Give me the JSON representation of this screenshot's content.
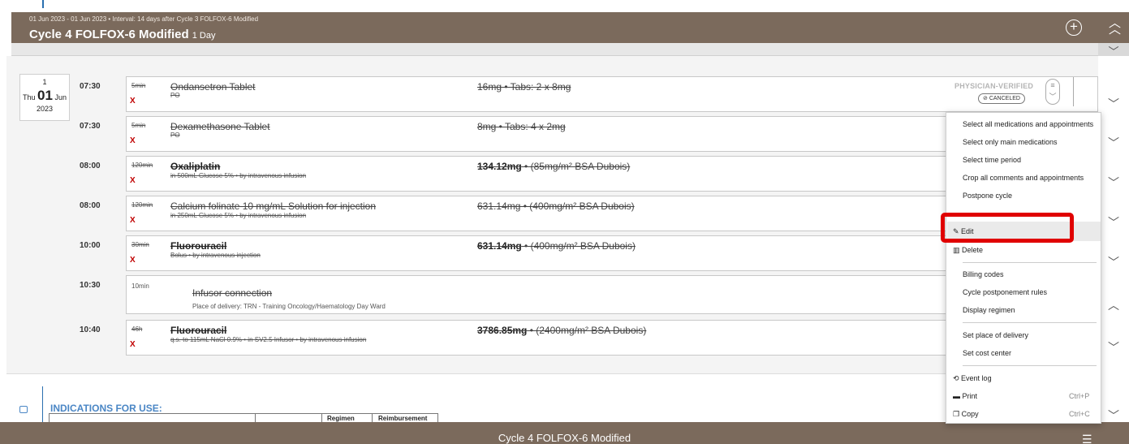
{
  "cycle": {
    "subtitle": "01 Jun 2023 - 01 Jun 2023 • Interval: 14 days after Cycle 3 FOLFOX-6 Modified",
    "title": "Cycle 4 FOLFOX-6 Modified",
    "days": "1 Day"
  },
  "date": {
    "day_num": "1",
    "weekday": "Thu",
    "day": "01",
    "month": "Jun",
    "year": "2023"
  },
  "status": {
    "verified": "PHYSICIAN-VERIFIED",
    "canceled": "CANCELED"
  },
  "rows": [
    {
      "time": "07:30",
      "duration": "5min",
      "name": "Ondansetron Tablet",
      "sub": "PO",
      "dose": "16mg • Tabs: 2 x 8mg",
      "dose_bold": "",
      "cancel": "X"
    },
    {
      "time": "07:30",
      "duration": "5min",
      "name": "Dexamethasone Tablet",
      "sub": "PO",
      "dose": "8mg • Tabs: 4 x 2mg",
      "dose_bold": "",
      "cancel": "X"
    },
    {
      "time": "08:00",
      "duration": "120min",
      "name": "Oxaliplatin",
      "sub": "in 500mL Glucose 5% • by intravenous infusion",
      "dose_bold": "134.12mg",
      "dose": " • (85mg/m² BSA Dubois)",
      "cancel": "X"
    },
    {
      "time": "08:00",
      "duration": "120min",
      "name": "Calcium folinate 10 mg/mL Solution for injection",
      "sub": "in 250mL Glucose 5% • by intravenous infusion",
      "dose": "631.14mg • (400mg/m² BSA Dubois)",
      "dose_bold": "",
      "cancel": "X"
    },
    {
      "time": "10:00",
      "duration": "30min",
      "name": "Fluorouracil",
      "sub": "Bolus • by intravenous injection",
      "dose_bold": "631.14mg",
      "dose": " • (400mg/m² BSA Dubois)",
      "cancel": "X"
    },
    {
      "time": "10:30",
      "duration": "10min",
      "name": "Infusor connection",
      "sub": "Place of delivery: TRN - Training Oncology/Haematology Day Ward"
    },
    {
      "time": "10:40",
      "duration": "46h",
      "name": "Fluorouracil",
      "sub": "q.s. to 115mL NaCl 0.9% • in SV2.5 Infusor • by intravenous infusion",
      "dose_bold": "3786.85mg",
      "dose": " • (2400mg/m² BSA Dubois)",
      "cancel": "X"
    }
  ],
  "indications": {
    "label": "INDICATIONS FOR USE:",
    "columns": [
      "Regimen",
      "Reimbursement"
    ]
  },
  "footer": {
    "title": "Cycle 4 FOLFOX-6 Modified"
  },
  "menu": {
    "items": [
      "Select all medications and appointments",
      "Select only main medications",
      "Select time period",
      "Crop all comments and appointments",
      "Postpone cycle",
      "Edit",
      "Delete",
      "Billing codes",
      "Cycle postponement rules",
      "Display regimen",
      "Set place of delivery",
      "Set cost center",
      "Event log",
      "Print",
      "Copy"
    ],
    "shortcuts": {
      "print": "Ctrl+P",
      "copy": "Ctrl+C"
    }
  }
}
